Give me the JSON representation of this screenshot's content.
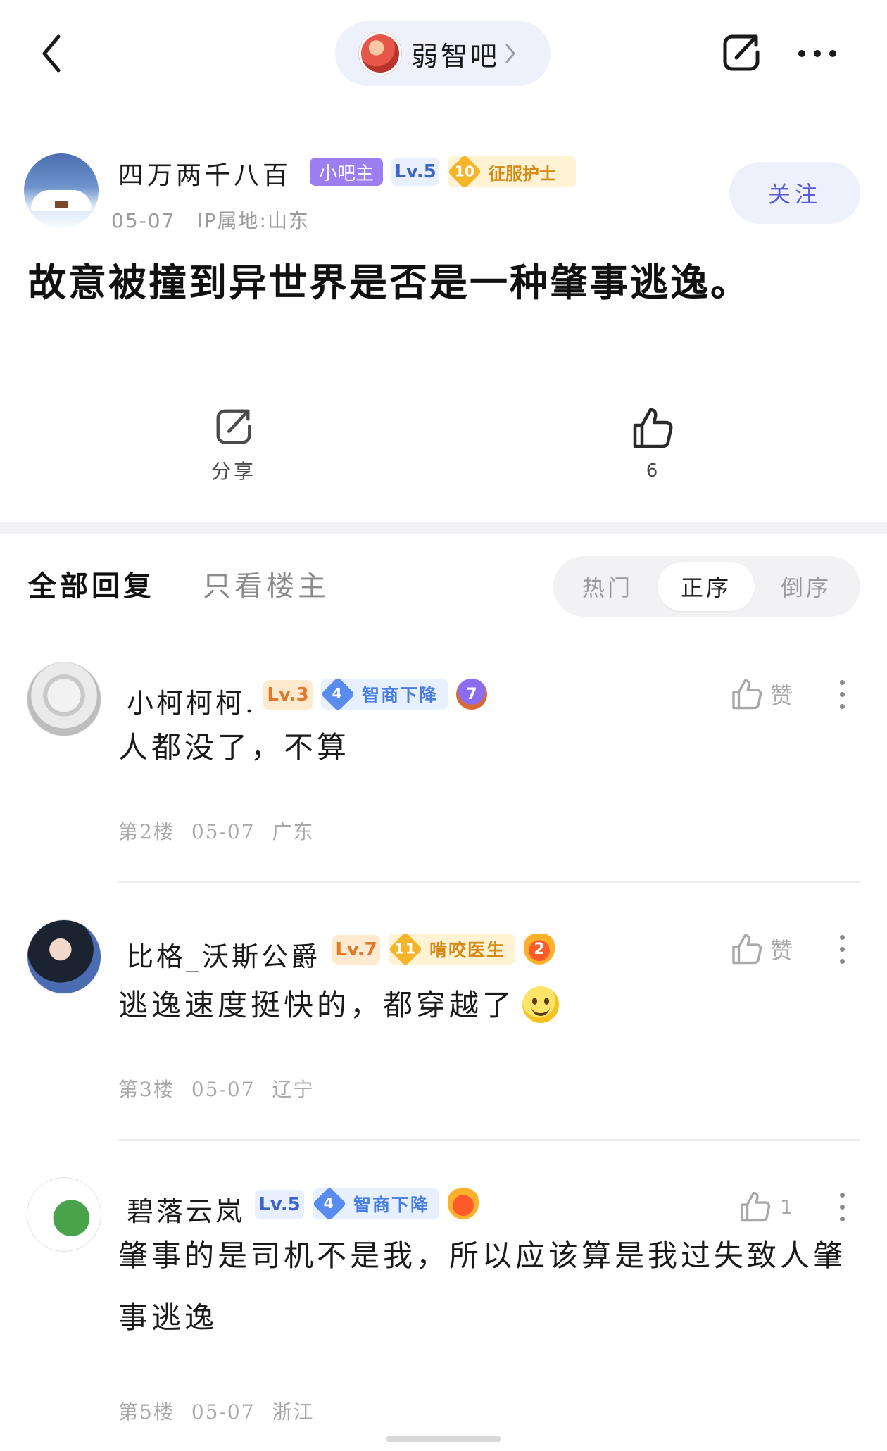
{
  "topbar": {
    "forum_name": "弱智吧"
  },
  "post": {
    "author": {
      "name": "四万两千八百",
      "role_badge": "小吧主",
      "level": "Lv.5",
      "honor_level": "10",
      "honor_title": "征服护士",
      "date": "05-07",
      "ip": "IP属地:山东"
    },
    "follow_label": "关注",
    "title": "故意被撞到异世界是否是一种肇事逃逸。",
    "share_label": "分享",
    "like_count": "6"
  },
  "tabs": {
    "all": "全部回复",
    "op_only": "只看楼主",
    "sort": {
      "hot": "热门",
      "asc": "正序",
      "desc": "倒序"
    }
  },
  "replies": [
    {
      "name": "小柯柯柯.",
      "level": "Lv.3",
      "badge_level": "4",
      "badge_title": "智商下降",
      "emblem": "7",
      "like_label": "赞",
      "content": "人都没了，不算",
      "floor": "第2楼",
      "date": "05-07",
      "region": "广东"
    },
    {
      "name": "比格_沃斯公爵",
      "level": "Lv.7",
      "badge_level": "11",
      "badge_title": "啃咬医生",
      "emblem": "2",
      "like_label": "赞",
      "content": "逃逸速度挺快的，都穿越了",
      "floor": "第3楼",
      "date": "05-07",
      "region": "辽宁"
    },
    {
      "name": "碧落云岚",
      "level": "Lv.5",
      "badge_level": "4",
      "badge_title": "智商下降",
      "emblem": "",
      "like_count": "1",
      "content": "肇事的是司机不是我，所以应该算是我过失致人肇事逃逸",
      "floor": "第5楼",
      "date": "05-07",
      "region": "浙江"
    }
  ],
  "colors": {
    "accent": "#5a59d6",
    "pill_bg": "#eef0fb",
    "barmaster": "#9c7ef0",
    "muted": "#9a9a9a"
  },
  "icons": [
    "back-icon",
    "chevron-right-icon",
    "share-icon",
    "more-icon",
    "thumb-up-icon",
    "smile-emoji-icon"
  ]
}
